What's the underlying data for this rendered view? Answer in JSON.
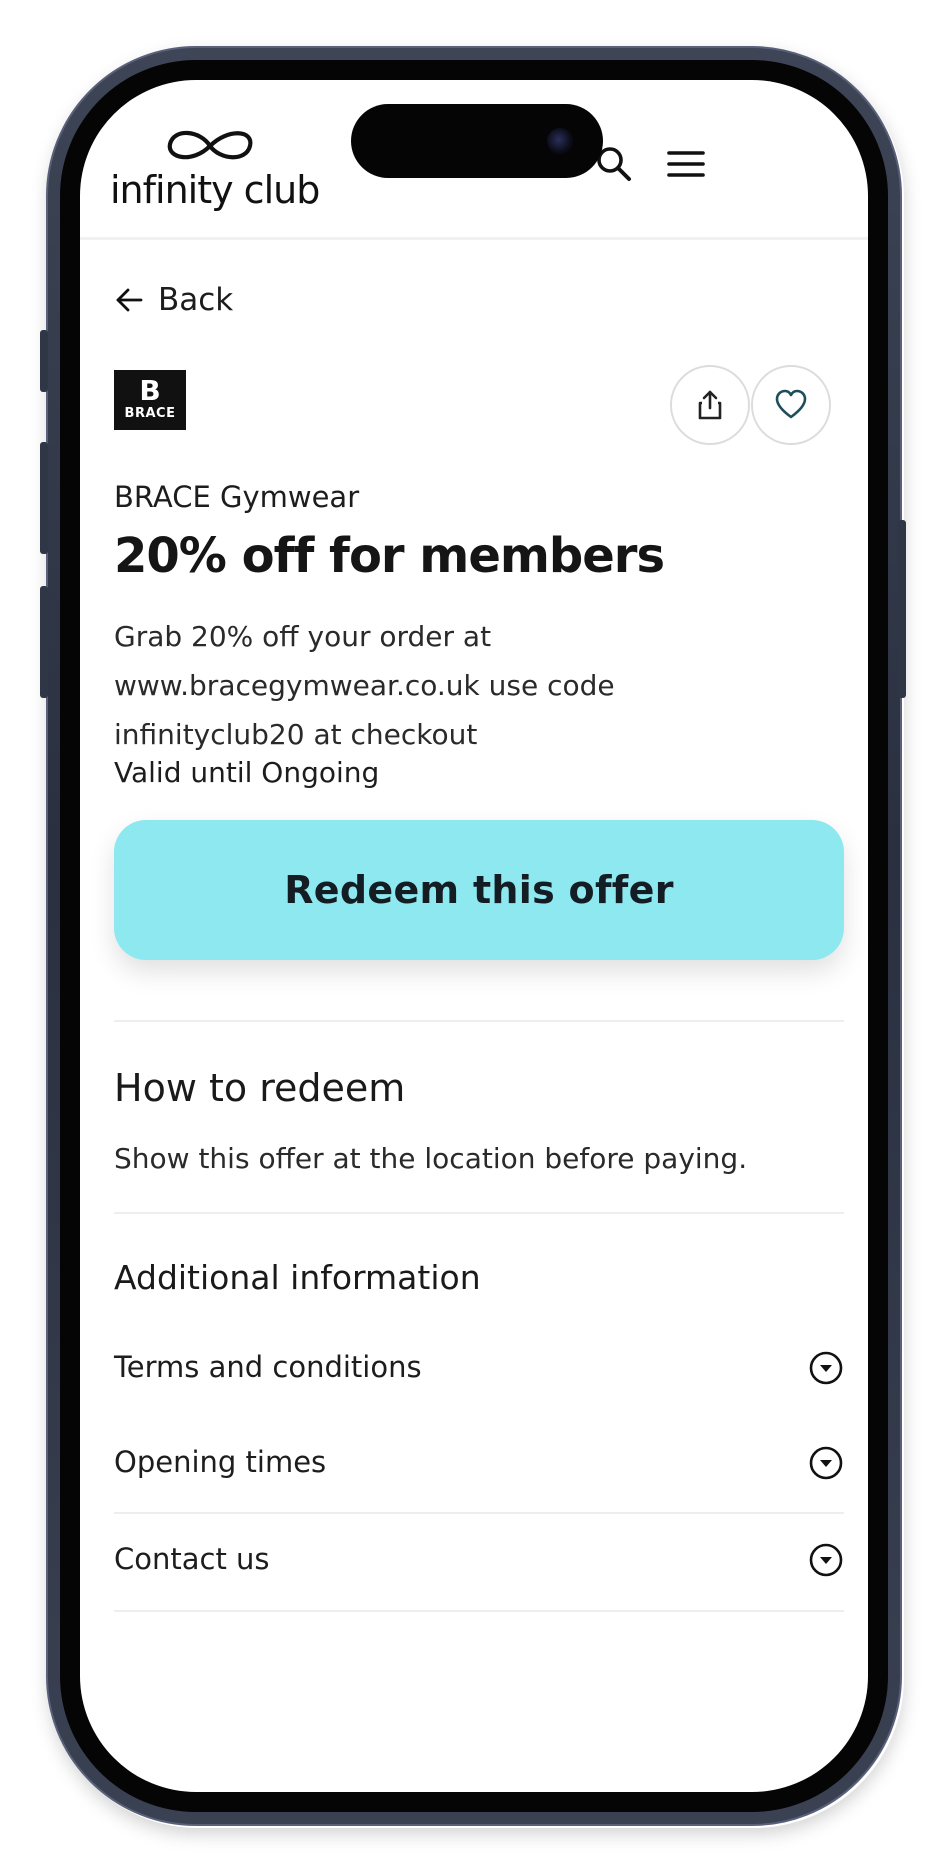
{
  "header": {
    "logo_text": "infinity club",
    "search_icon": "search-icon",
    "menu_icon": "hamburger-menu-icon"
  },
  "nav": {
    "back_label": "Back"
  },
  "offer": {
    "brand_logo_initial": "B",
    "brand_logo_word": "BRACE",
    "brand_name": "BRACE Gymwear",
    "title": "20% off for members",
    "description": "Grab 20% off your order at www.bracegymwear.co.uk use code infinityclub20 at checkout",
    "valid_until": "Valid until Ongoing",
    "redeem_label": "Redeem this offer",
    "share_icon": "share-icon",
    "favorite_icon": "heart-icon"
  },
  "how_to_redeem": {
    "title": "How to redeem",
    "text": "Show this offer at the location before paying."
  },
  "additional": {
    "title": "Additional information",
    "items": [
      {
        "label": "Terms and conditions",
        "icon": "chevron-down-circle-icon"
      },
      {
        "label": "Opening times",
        "icon": "chevron-down-circle-icon"
      },
      {
        "label": "Contact us",
        "icon": "chevron-down-circle-icon"
      }
    ]
  },
  "colors": {
    "accent": "#8de9ef",
    "text": "#1a1a1a",
    "frame": "#2a3040"
  }
}
